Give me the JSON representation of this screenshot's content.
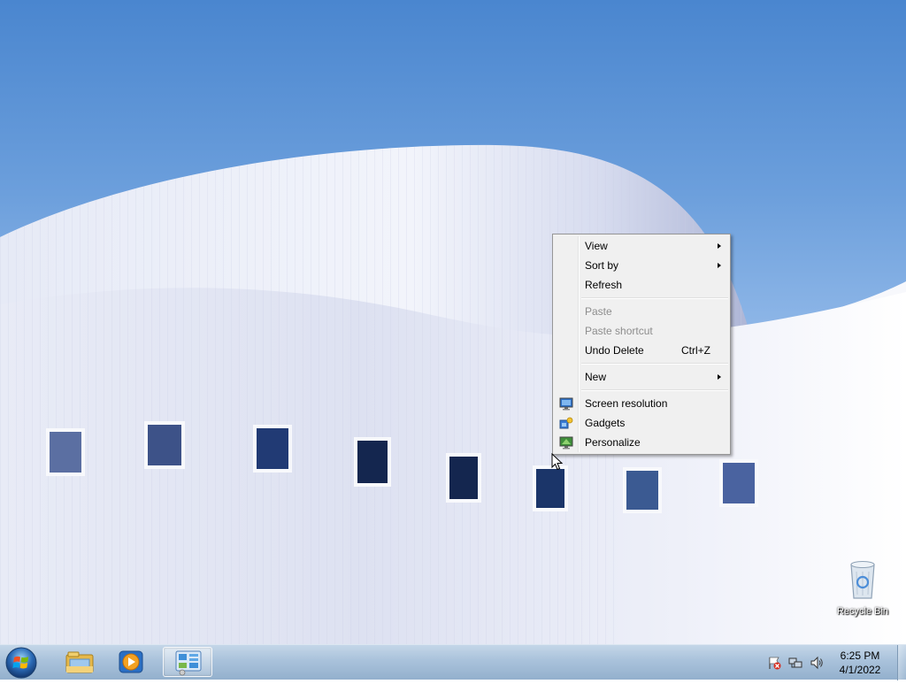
{
  "desktop": {
    "icons": [
      {
        "label": "Recycle Bin",
        "icon": "recycle-bin-icon"
      }
    ]
  },
  "context_menu": {
    "items": [
      {
        "label": "View",
        "submenu": true
      },
      {
        "label": "Sort by",
        "submenu": true
      },
      {
        "label": "Refresh"
      },
      {
        "label": "Paste",
        "disabled": true
      },
      {
        "label": "Paste shortcut",
        "disabled": true
      },
      {
        "label": "Undo Delete",
        "shortcut": "Ctrl+Z"
      },
      {
        "label": "New",
        "submenu": true
      },
      {
        "label": "Screen resolution",
        "icon": "screen-resolution-icon"
      },
      {
        "label": "Gadgets",
        "icon": "gadgets-icon"
      },
      {
        "label": "Personalize",
        "icon": "personalize-icon"
      }
    ]
  },
  "taskbar": {
    "start_icon": "windows-start-orb-icon",
    "pinned": [
      {
        "icon": "windows-explorer-icon"
      },
      {
        "icon": "media-player-icon"
      },
      {
        "icon": "control-panel-icon",
        "active": true
      }
    ],
    "tray": [
      {
        "icon": "action-center-flag-icon"
      },
      {
        "icon": "network-icon"
      },
      {
        "icon": "volume-icon"
      }
    ],
    "clock": {
      "time": "6:25 PM",
      "date": "4/1/2022"
    }
  },
  "colors": {
    "sky": "#6c9fdc",
    "taskbar": "#a9c2db",
    "menu_bg": "#f0f0f0"
  }
}
